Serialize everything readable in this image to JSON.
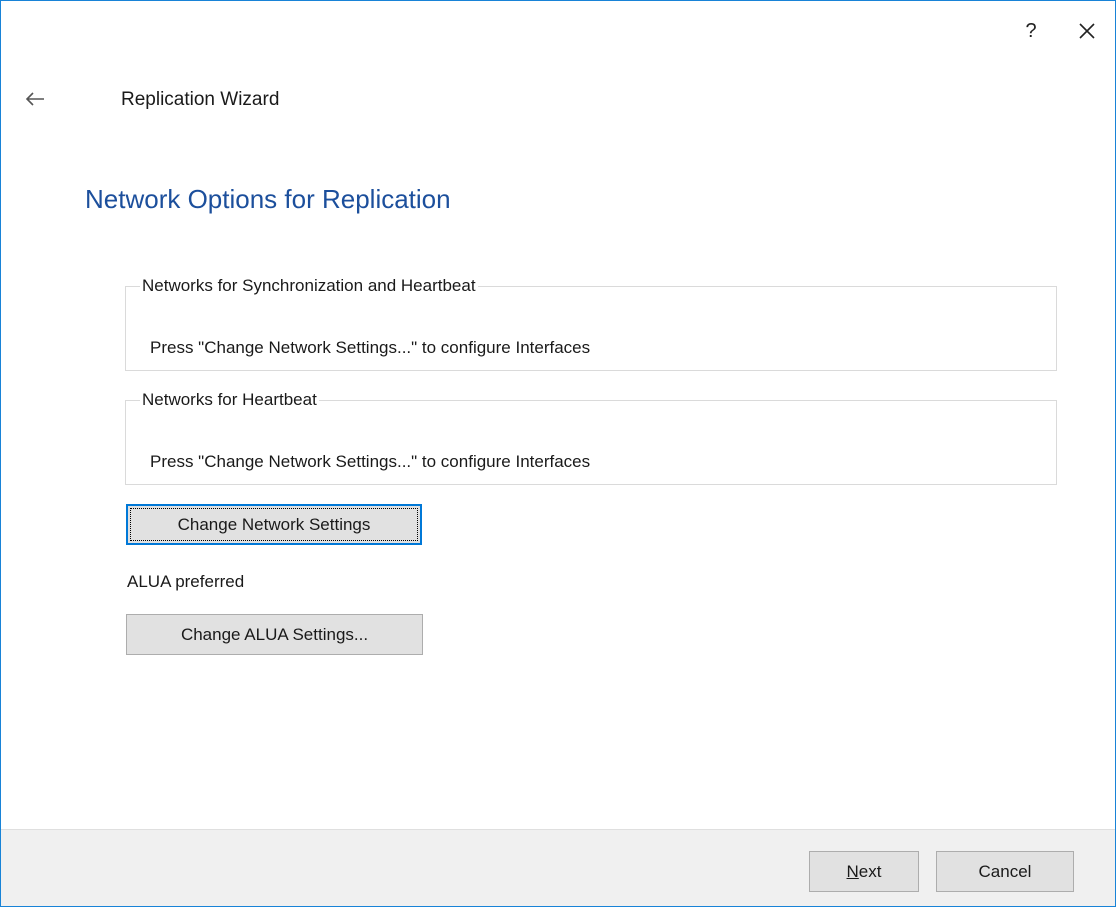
{
  "window": {
    "help_label": "?",
    "wizard_title": "Replication Wizard",
    "page_heading": "Network Options for Replication"
  },
  "groups": {
    "sync": {
      "legend": "Networks for Synchronization and Heartbeat",
      "text": "Press \"Change Network Settings...\" to configure Interfaces"
    },
    "heartbeat": {
      "legend": "Networks for Heartbeat",
      "text": "Press \"Change Network Settings...\" to configure Interfaces"
    }
  },
  "buttons": {
    "change_network": "Change Network Settings",
    "alua_status": "ALUA preferred",
    "change_alua": "Change ALUA Settings...",
    "next": "Next",
    "cancel": "Cancel"
  },
  "colors": {
    "heading": "#1c4f9c",
    "focus": "#0078d7",
    "window_border": "#1883d7"
  },
  "icons": {
    "back": "back-arrow-icon",
    "close": "close-icon"
  }
}
